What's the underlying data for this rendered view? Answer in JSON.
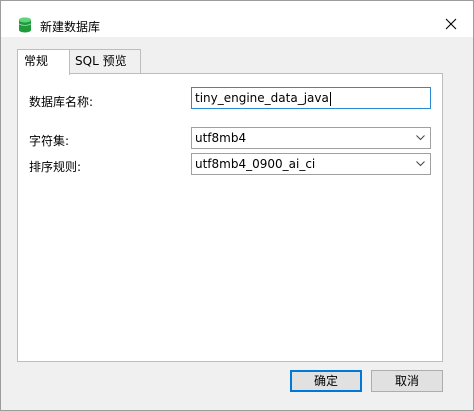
{
  "window": {
    "title": "新建数据库"
  },
  "tabs": [
    {
      "label": "常规",
      "active": true
    },
    {
      "label": "SQL 预览",
      "active": false
    }
  ],
  "form": {
    "db_name_label": "数据库名称:",
    "db_name_value": "tiny_engine_data_java",
    "charset_label": "字符集:",
    "charset_value": "utf8mb4",
    "collation_label": "排序规则:",
    "collation_value": "utf8mb4_0900_ai_ci"
  },
  "buttons": {
    "ok": "确定",
    "cancel": "取消"
  },
  "colors": {
    "focus_border": "#2a8ad5",
    "primary_border": "#0078d7",
    "db_icon": "#1e9b3a"
  },
  "icons": {
    "title": "database-icon",
    "close": "close-icon",
    "dropdown": "chevron-down-icon"
  }
}
